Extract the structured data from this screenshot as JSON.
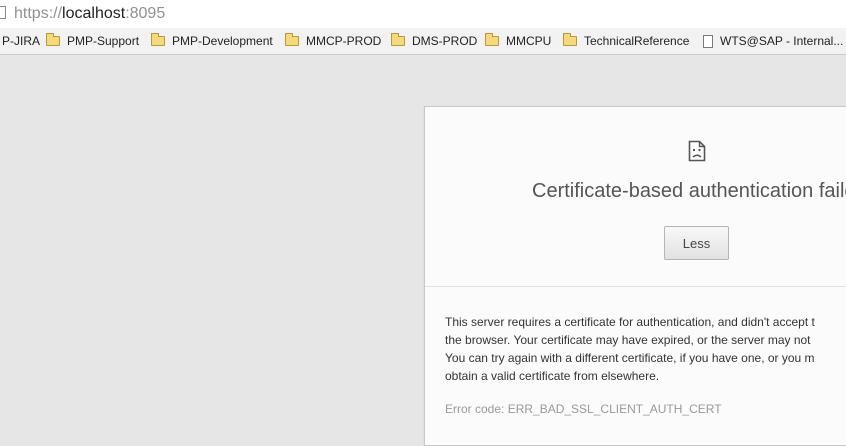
{
  "address_bar": {
    "scheme": "https://",
    "host": "localhost",
    "port": ":8095"
  },
  "bookmarks": [
    {
      "label": "P-JIRA",
      "icon": "folder-icon"
    },
    {
      "label": "PMP-Support",
      "icon": "folder-icon"
    },
    {
      "label": "PMP-Development",
      "icon": "folder-icon"
    },
    {
      "label": "MMCP-PROD",
      "icon": "folder-icon"
    },
    {
      "label": "DMS-PROD",
      "icon": "folder-icon"
    },
    {
      "label": "MMCPU",
      "icon": "folder-icon"
    },
    {
      "label": "TechnicalReference",
      "icon": "folder-icon"
    },
    {
      "label": "WTS@SAP - Internal...",
      "icon": "page-icon"
    }
  ],
  "error": {
    "icon": "sad-page-icon",
    "title": "Certificate-based authentication faile",
    "less_label": "Less",
    "details_lines": [
      "This server requires a certificate for authentication, and didn't accept t",
      "the browser. Your certificate may have expired, or the server may not",
      "You can try again with a different certificate, if you have one, or you m",
      "obtain a valid certificate from elsewhere."
    ],
    "error_code": "Error code: ERR_BAD_SSL_CLIENT_AUTH_CERT"
  }
}
